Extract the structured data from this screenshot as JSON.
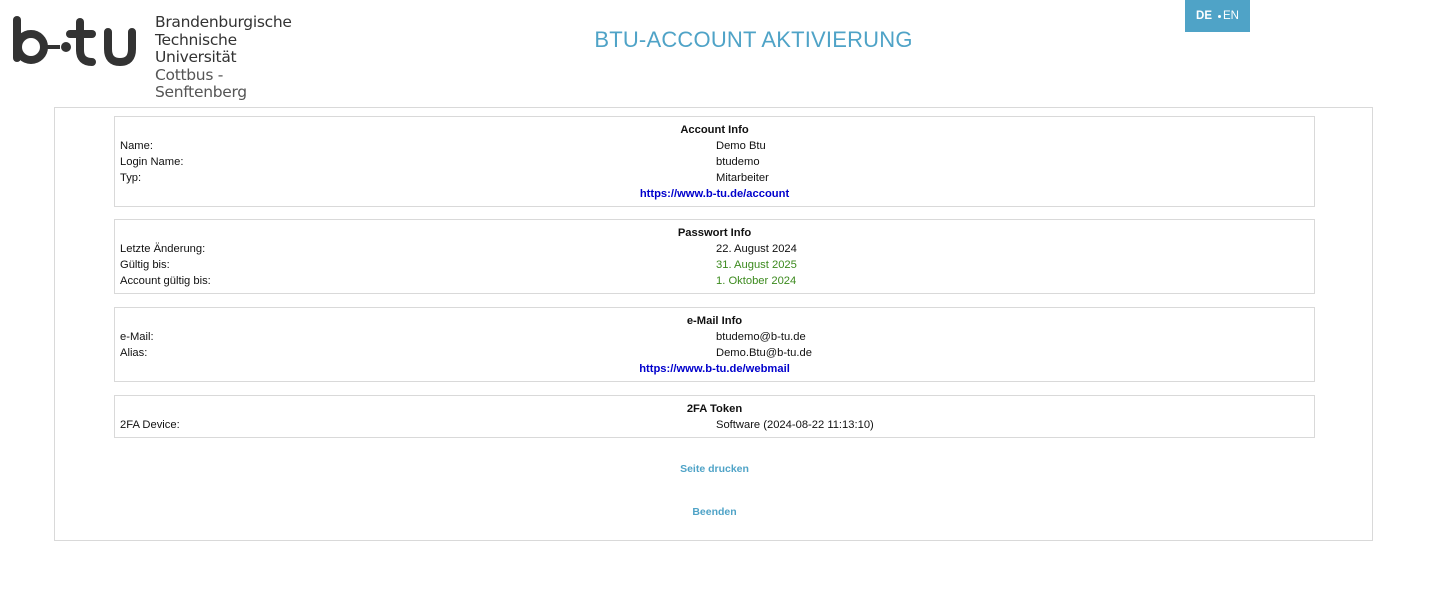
{
  "logo": {
    "line1": "Brandenburgische",
    "line2": "Technische Universität",
    "line3": "Cottbus - Senftenberg"
  },
  "header": {
    "title": "BTU-ACCOUNT AKTIVIERUNG"
  },
  "lang": {
    "de": "DE",
    "en": "EN"
  },
  "account": {
    "heading": "Account Info",
    "rows": [
      {
        "label": "Name:",
        "value": "Demo Btu"
      },
      {
        "label": "Login Name:",
        "value": "btudemo"
      },
      {
        "label": "Typ:",
        "value": "Mitarbeiter"
      }
    ],
    "link": "https://www.b-tu.de/account"
  },
  "password": {
    "heading": "Passwort Info",
    "rows": [
      {
        "label": "Letzte Änderung:",
        "value": "22. August 2024"
      },
      {
        "label": "Gültig bis:",
        "value": "31. August 2025"
      },
      {
        "label": "Account gültig bis:",
        "value": "1. Oktober 2024"
      }
    ]
  },
  "email": {
    "heading": "e-Mail Info",
    "rows": [
      {
        "label": "e-Mail:",
        "value": "btudemo@b-tu.de"
      },
      {
        "label": "Alias:",
        "value": "Demo.Btu@b-tu.de"
      }
    ],
    "link": "https://www.b-tu.de/webmail"
  },
  "token": {
    "heading": "2FA Token",
    "rows": [
      {
        "label": "2FA Device:",
        "value": "Software (2024-08-22 11:13:10)"
      }
    ]
  },
  "actions": {
    "print": "Seite drucken",
    "quit": "Beenden"
  },
  "colors": {
    "accent": "#4fa3c7",
    "link": "#0000cc",
    "valid": "#3c8a1e"
  }
}
